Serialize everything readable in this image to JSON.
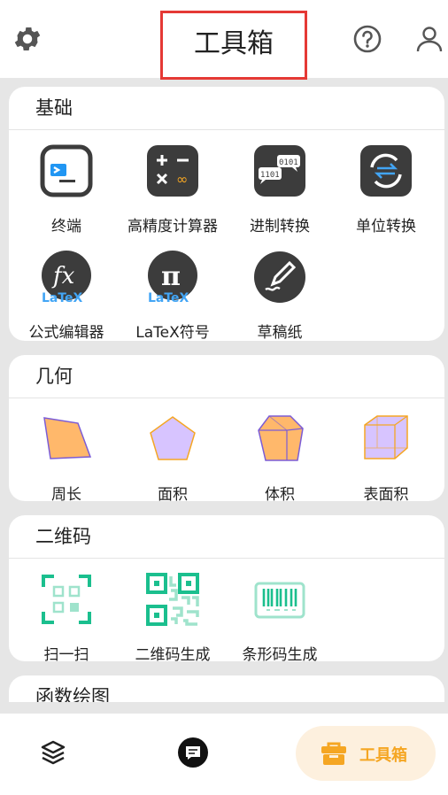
{
  "header": {
    "title": "工具箱"
  },
  "sections": [
    {
      "title": "基础",
      "tools": [
        {
          "label": "终端",
          "icon": "terminal-icon"
        },
        {
          "label": "高精度计算器",
          "icon": "calculator-icon"
        },
        {
          "label": "进制转换",
          "icon": "base-conversion-icon"
        },
        {
          "label": "单位转换",
          "icon": "unit-conversion-icon"
        },
        {
          "label": "公式编辑器",
          "icon": "formula-editor-icon",
          "badge": "LaTeX"
        },
        {
          "label": "LaTeX符号",
          "icon": "latex-symbol-icon",
          "badge": "LaTeX"
        },
        {
          "label": "草稿纸",
          "icon": "draft-paper-icon"
        }
      ]
    },
    {
      "title": "几何",
      "tools": [
        {
          "label": "周长",
          "icon": "perimeter-icon"
        },
        {
          "label": "面积",
          "icon": "area-icon"
        },
        {
          "label": "体积",
          "icon": "volume-icon"
        },
        {
          "label": "表面积",
          "icon": "surface-area-icon"
        }
      ]
    },
    {
      "title": "二维码",
      "tools": [
        {
          "label": "扫一扫",
          "icon": "scan-icon"
        },
        {
          "label": "二维码生成",
          "icon": "qr-generate-icon"
        },
        {
          "label": "条形码生成",
          "icon": "barcode-generate-icon"
        }
      ]
    },
    {
      "title": "函数绘图",
      "tools": []
    }
  ],
  "bottom_nav": {
    "active_label": "工具箱"
  },
  "colors": {
    "accent": "#f5a623",
    "accent_bg": "#fdf0de",
    "title_outline": "#e53935",
    "tool_icon_dark": "#3c3c3c",
    "geometry_orange": "#ffb86b",
    "geometry_purple": "#d7c4ff",
    "qr_green": "#1bbf8e"
  }
}
